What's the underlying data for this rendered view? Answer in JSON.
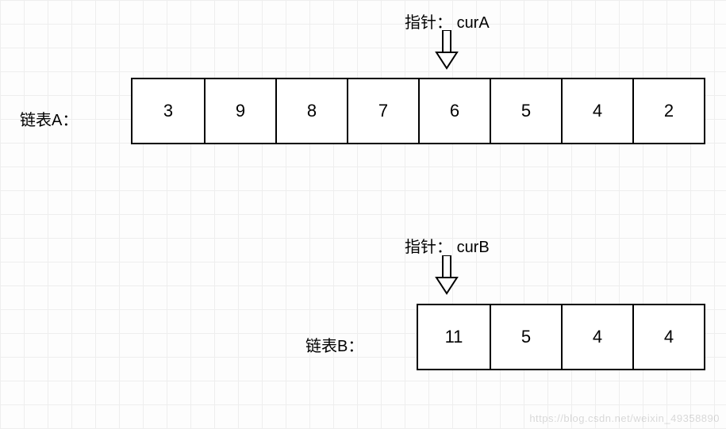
{
  "pointerA": {
    "label": "指针：",
    "name": "curA"
  },
  "pointerB": {
    "label": "指针：",
    "name": "curB"
  },
  "listA": {
    "label": "链表A：",
    "cells": [
      "3",
      "9",
      "8",
      "7",
      "6",
      "5",
      "4",
      "2"
    ]
  },
  "listB": {
    "label": "链表B：",
    "cells": [
      "11",
      "5",
      "4",
      "4"
    ]
  },
  "watermark": "https://blog.csdn.net/weixin_49358890",
  "chart_data": {
    "type": "table",
    "description": "Two linked lists A and B with pointers curA and curB positioned at aligned starting nodes for intersection traversal",
    "lists": [
      {
        "name": "链表A",
        "values": [
          3,
          9,
          8,
          7,
          6,
          5,
          4,
          2
        ],
        "pointer": {
          "name": "curA",
          "index": 4
        }
      },
      {
        "name": "链表B",
        "values": [
          11,
          5,
          4,
          4
        ],
        "pointer": {
          "name": "curB",
          "index": 0
        }
      }
    ]
  }
}
